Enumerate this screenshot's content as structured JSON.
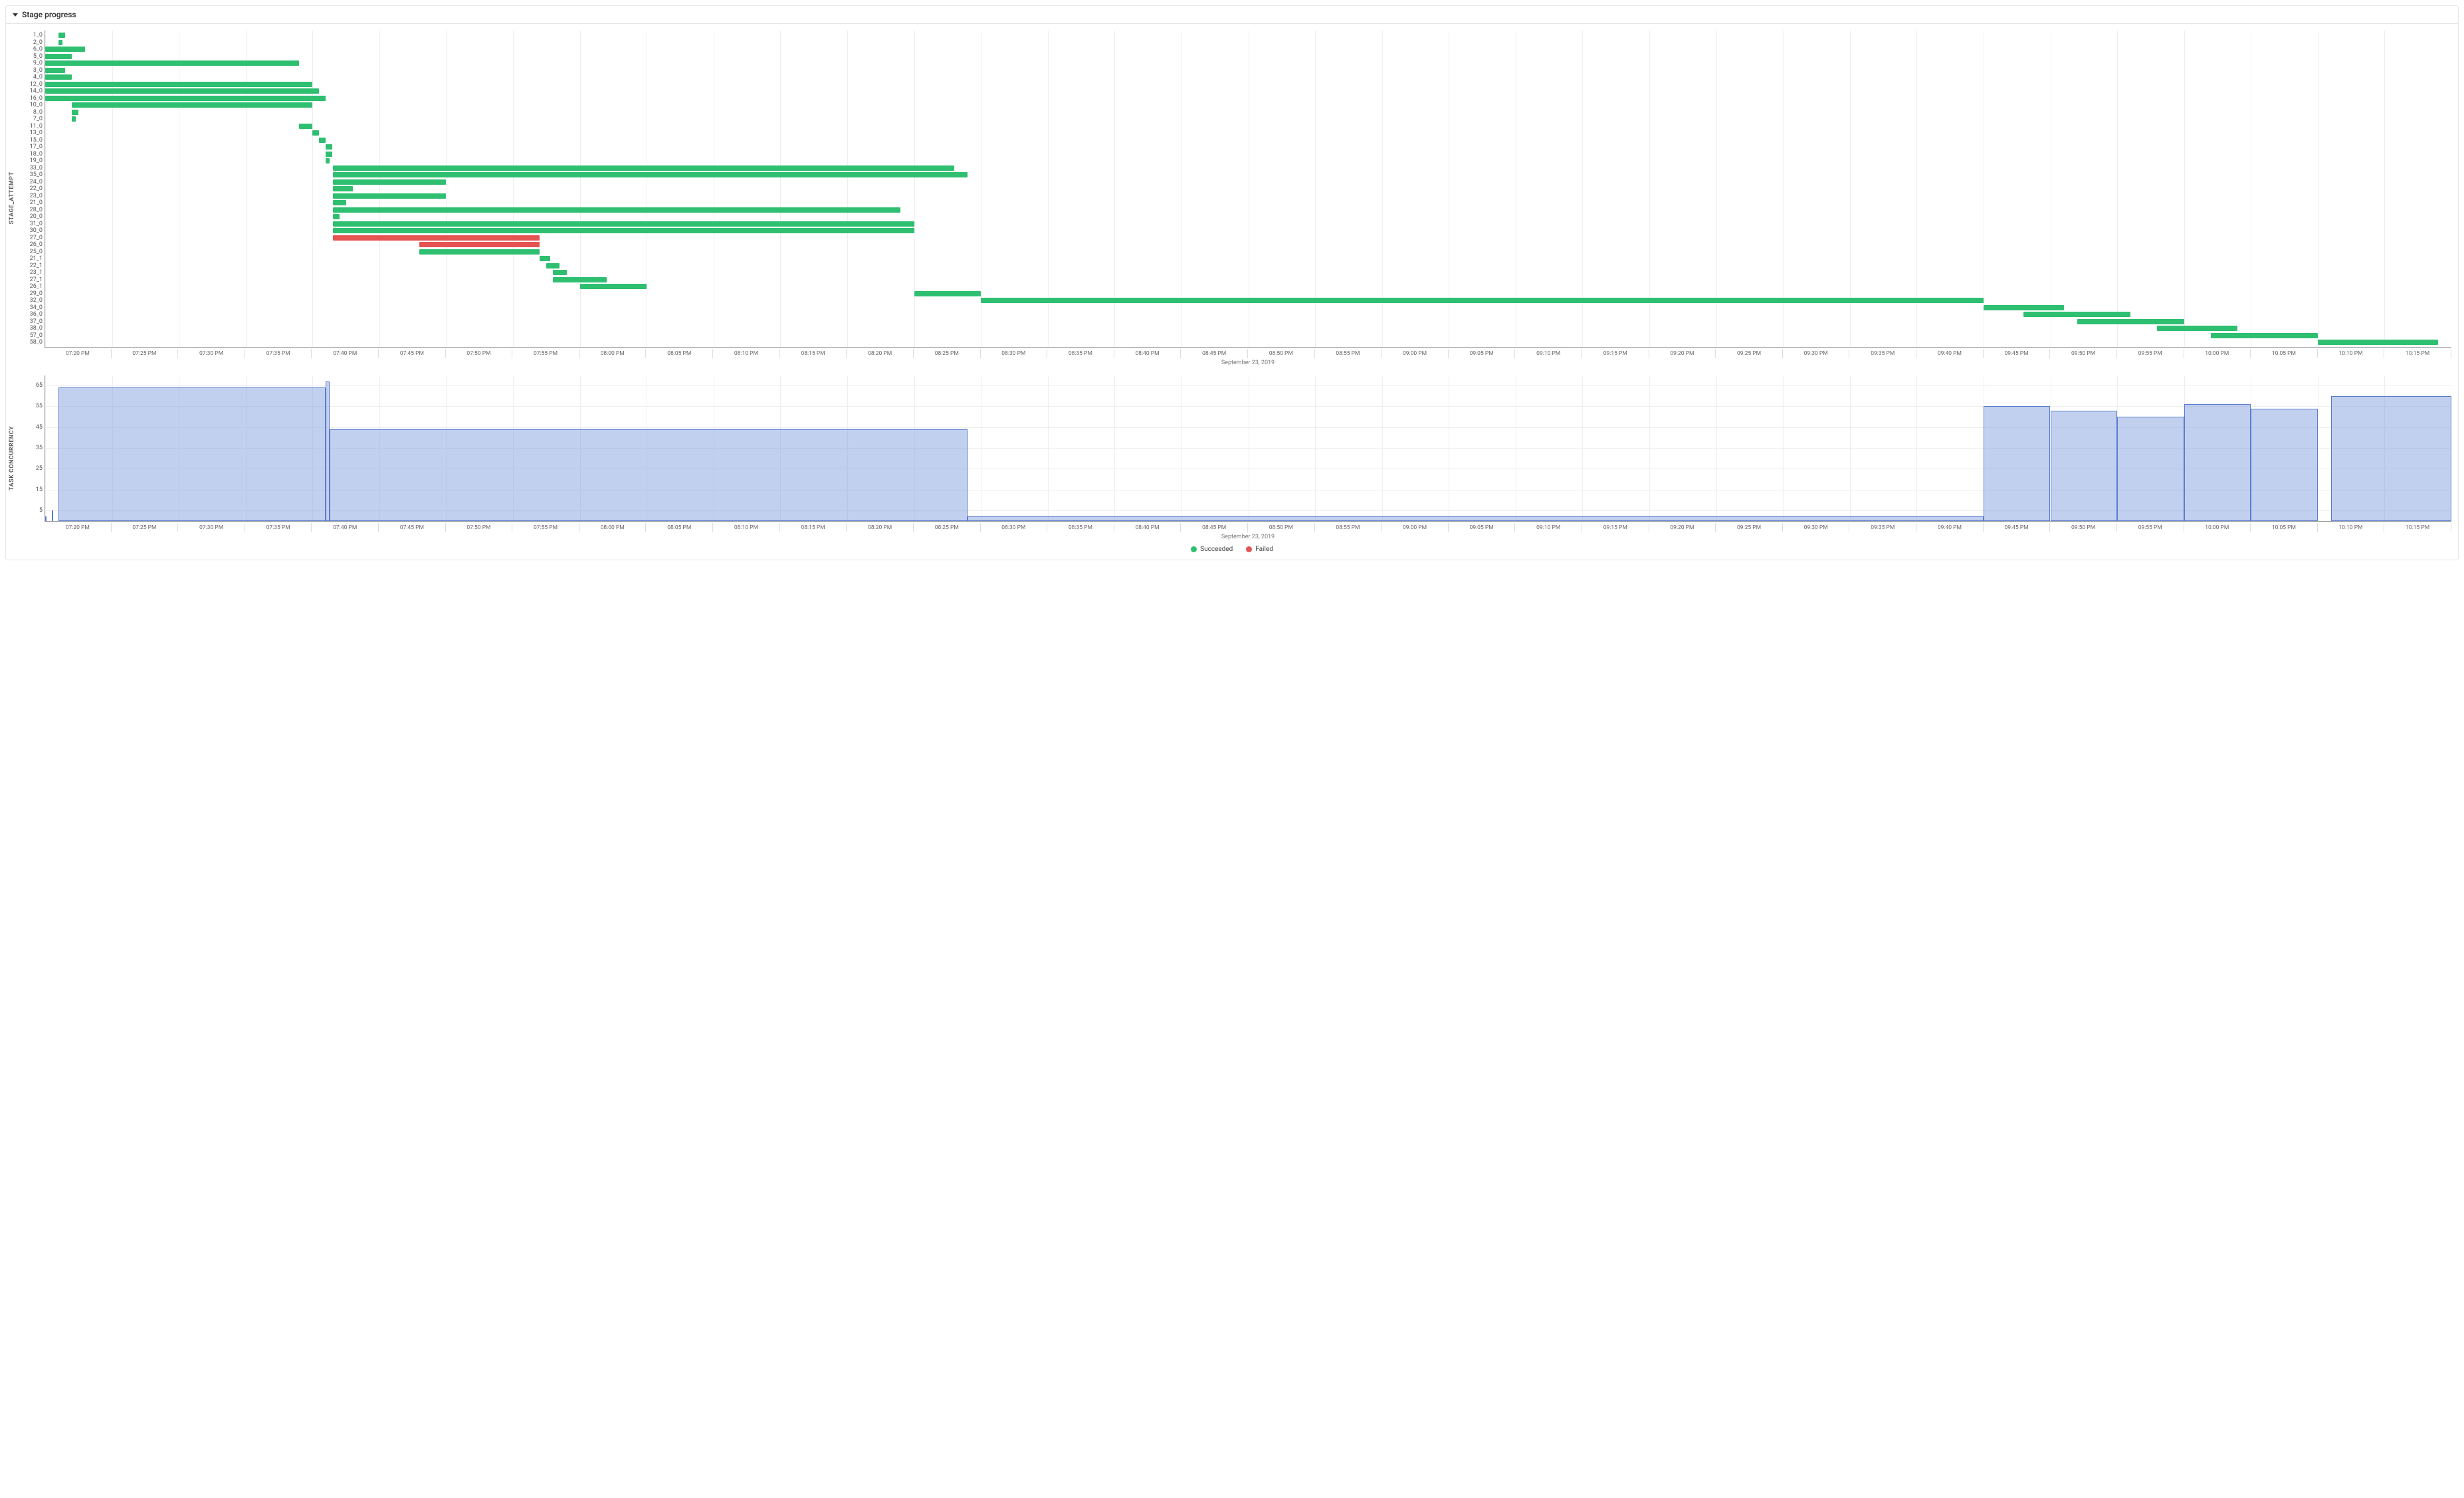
{
  "header": {
    "title": "Stage progress"
  },
  "legend": {
    "succeeded": "Succeeded",
    "failed": "Failed"
  },
  "axis_date": "September 23, 2019",
  "yaxis_gantt": "STAGE_ATTEMPT",
  "yaxis_bar": "TASK CONCURRENCY",
  "colors": {
    "succeeded": "#2fbf71",
    "failed": "#e55353",
    "bar": "#5a7bd0"
  },
  "chart_data": {
    "time_axis": {
      "start_min": 0,
      "end_min": 180,
      "ticks": [
        "07:20 PM",
        "07:25 PM",
        "07:30 PM",
        "07:35 PM",
        "07:40 PM",
        "07:45 PM",
        "07:50 PM",
        "07:55 PM",
        "08:00 PM",
        "08:05 PM",
        "08:10 PM",
        "08:15 PM",
        "08:20 PM",
        "08:25 PM",
        "08:30 PM",
        "08:35 PM",
        "08:40 PM",
        "08:45 PM",
        "08:50 PM",
        "08:55 PM",
        "09:00 PM",
        "09:05 PM",
        "09:10 PM",
        "09:15 PM",
        "09:20 PM",
        "09:25 PM",
        "09:30 PM",
        "09:35 PM",
        "09:40 PM",
        "09:45 PM",
        "09:50 PM",
        "09:55 PM",
        "10:00 PM",
        "10:05 PM",
        "10:10 PM",
        "10:15 PM"
      ]
    },
    "gantt": {
      "type": "gantt",
      "rows": [
        {
          "label": "1_0",
          "start": 1,
          "end": 1.5,
          "status": "succeeded"
        },
        {
          "label": "2_0",
          "start": 1,
          "end": 1.3,
          "status": "succeeded"
        },
        {
          "label": "6_0",
          "start": 0,
          "end": 3,
          "status": "succeeded"
        },
        {
          "label": "5_0",
          "start": 0,
          "end": 2,
          "status": "succeeded"
        },
        {
          "label": "9_0",
          "start": 0,
          "end": 19,
          "status": "succeeded"
        },
        {
          "label": "3_0",
          "start": 0,
          "end": 1.5,
          "status": "succeeded"
        },
        {
          "label": "4_0",
          "start": 0,
          "end": 2,
          "status": "succeeded"
        },
        {
          "label": "12_0",
          "start": 0,
          "end": 20,
          "status": "succeeded"
        },
        {
          "label": "14_0",
          "start": 0,
          "end": 20.5,
          "status": "succeeded"
        },
        {
          "label": "16_0",
          "start": 0,
          "end": 21,
          "status": "succeeded"
        },
        {
          "label": "10_0",
          "start": 2,
          "end": 20,
          "status": "succeeded"
        },
        {
          "label": "8_0",
          "start": 2,
          "end": 2.5,
          "status": "succeeded"
        },
        {
          "label": "7_0",
          "start": 2,
          "end": 2.3,
          "status": "succeeded"
        },
        {
          "label": "11_0",
          "start": 19,
          "end": 20,
          "status": "succeeded"
        },
        {
          "label": "13_0",
          "start": 20,
          "end": 20.5,
          "status": "succeeded"
        },
        {
          "label": "15_0",
          "start": 20.5,
          "end": 21,
          "status": "succeeded"
        },
        {
          "label": "17_0",
          "start": 21,
          "end": 21.5,
          "status": "succeeded"
        },
        {
          "label": "18_0",
          "start": 21,
          "end": 21.5,
          "status": "succeeded"
        },
        {
          "label": "19_0",
          "start": 21,
          "end": 21.3,
          "status": "succeeded"
        },
        {
          "label": "33_0",
          "start": 21.5,
          "end": 68,
          "status": "succeeded"
        },
        {
          "label": "35_0",
          "start": 21.5,
          "end": 69,
          "status": "succeeded"
        },
        {
          "label": "24_0",
          "start": 21.5,
          "end": 30,
          "status": "succeeded"
        },
        {
          "label": "22_0",
          "start": 21.5,
          "end": 23,
          "status": "succeeded"
        },
        {
          "label": "23_0",
          "start": 21.5,
          "end": 30,
          "status": "succeeded"
        },
        {
          "label": "21_0",
          "start": 21.5,
          "end": 22.5,
          "status": "succeeded"
        },
        {
          "label": "28_0",
          "start": 21.5,
          "end": 64,
          "status": "succeeded"
        },
        {
          "label": "20_0",
          "start": 21.5,
          "end": 22,
          "status": "succeeded"
        },
        {
          "label": "31_0",
          "start": 21.5,
          "end": 65,
          "status": "succeeded"
        },
        {
          "label": "30_0",
          "start": 21.5,
          "end": 65,
          "status": "succeeded"
        },
        {
          "label": "27_0",
          "start": 21.5,
          "end": 37,
          "status": "failed"
        },
        {
          "label": "26_0",
          "start": 28,
          "end": 37,
          "status": "failed"
        },
        {
          "label": "25_0",
          "start": 28,
          "end": 37,
          "status": "succeeded"
        },
        {
          "label": "21_1",
          "start": 37,
          "end": 37.8,
          "status": "succeeded"
        },
        {
          "label": "22_1",
          "start": 37.5,
          "end": 38.5,
          "status": "succeeded"
        },
        {
          "label": "23_1",
          "start": 38,
          "end": 39,
          "status": "succeeded"
        },
        {
          "label": "27_1",
          "start": 38,
          "end": 42,
          "status": "succeeded"
        },
        {
          "label": "26_1",
          "start": 40,
          "end": 45,
          "status": "succeeded"
        },
        {
          "label": "29_0",
          "start": 65,
          "end": 70,
          "status": "succeeded"
        },
        {
          "label": "32_0",
          "start": 70,
          "end": 145,
          "status": "succeeded"
        },
        {
          "label": "34_0",
          "start": 145,
          "end": 151,
          "status": "succeeded"
        },
        {
          "label": "36_0",
          "start": 148,
          "end": 156,
          "status": "succeeded"
        },
        {
          "label": "37_0",
          "start": 152,
          "end": 160,
          "status": "succeeded"
        },
        {
          "label": "38_0",
          "start": 158,
          "end": 164,
          "status": "succeeded"
        },
        {
          "label": "57_0",
          "start": 162,
          "end": 170,
          "status": "succeeded"
        },
        {
          "label": "58_0",
          "start": 170,
          "end": 179,
          "status": "succeeded"
        }
      ]
    },
    "concurrency": {
      "type": "bar",
      "ylim": [
        0,
        70
      ],
      "yticks": [
        5,
        15,
        25,
        35,
        45,
        55,
        65
      ],
      "events": [
        {
          "t": 0,
          "h": 2
        },
        {
          "t": 0.5,
          "h": 5
        }
      ],
      "blocks": [
        {
          "start": 1,
          "end": 21,
          "value": 64
        },
        {
          "start": 21,
          "end": 21.3,
          "value": 67
        },
        {
          "start": 21.3,
          "end": 69,
          "value": 44
        },
        {
          "start": 69,
          "end": 145,
          "value": 2
        },
        {
          "start": 145,
          "end": 150,
          "value": 55
        },
        {
          "start": 150,
          "end": 155,
          "value": 53
        },
        {
          "start": 155,
          "end": 160,
          "value": 50
        },
        {
          "start": 160,
          "end": 165,
          "value": 56
        },
        {
          "start": 165,
          "end": 170,
          "value": 54
        },
        {
          "start": 171,
          "end": 180,
          "value": 60
        }
      ]
    }
  }
}
